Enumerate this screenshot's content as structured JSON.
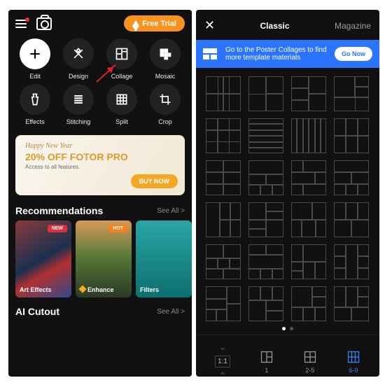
{
  "left": {
    "free_trial": "Free Trial",
    "tools": [
      {
        "label": "Edit",
        "icon": "plus"
      },
      {
        "label": "Design",
        "icon": "design"
      },
      {
        "label": "Collage",
        "icon": "collage"
      },
      {
        "label": "Mosaic",
        "icon": "mosaic"
      },
      {
        "label": "Effects",
        "icon": "flask"
      },
      {
        "label": "Stitching",
        "icon": "stitching"
      },
      {
        "label": "Split",
        "icon": "split"
      },
      {
        "label": "Crop",
        "icon": "crop"
      }
    ],
    "banner": {
      "line1": "Happy New Year",
      "line2": "20% OFF FOTOR PRO",
      "line3": "Access to all features.",
      "cta": "BUY NOW"
    },
    "sections": {
      "recs": {
        "title": "Recommendations",
        "see": "See All >"
      },
      "ai": {
        "title": "AI Cutout",
        "see": "See All >"
      }
    },
    "cards": [
      {
        "label": "Art Effects",
        "tag": "NEW",
        "tag_kind": "new"
      },
      {
        "label": "Enhance",
        "tag": "HOT",
        "tag_kind": "hot",
        "premium": true
      },
      {
        "label": "Filters",
        "tag": "",
        "tag_kind": ""
      }
    ]
  },
  "right": {
    "tabs": {
      "classic": "Classic",
      "magazine": "Magazine"
    },
    "promo": "Go to the Poster Collages to find more template materials",
    "go": "Go Now",
    "bottom": {
      "ratio": "1:1",
      "b1": "1",
      "b2": "2-5",
      "b3": "6-9"
    }
  }
}
